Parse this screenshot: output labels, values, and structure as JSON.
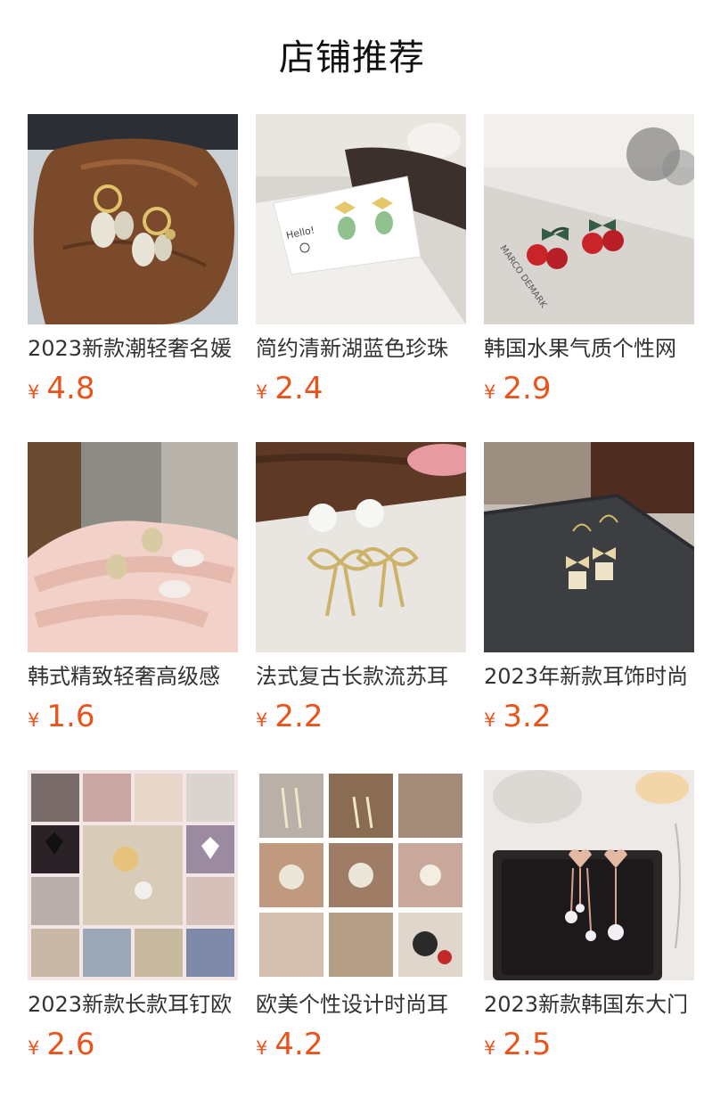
{
  "header": {
    "title": "店铺推荐"
  },
  "colors": {
    "price": "#e8541c",
    "text": "#333333"
  },
  "currency_symbol": "¥",
  "products": [
    {
      "name": "2023新款潮轻奢名媛",
      "price": "4.8",
      "image": "gold-rhinestone-leaf-hoop-earrings-on-wood"
    },
    {
      "name": "简约清新湖蓝色珍珠",
      "price": "2.4",
      "image": "gold-bow-green-drop-earrings-on-hello-card"
    },
    {
      "name": "韩国水果气质个性网",
      "price": "2.9",
      "image": "red-cherry-earrings-with-green-bow"
    },
    {
      "name": "韩式精致轻奢高级感",
      "price": "1.6",
      "image": "rhinestone-money-bag-stud-earrings-on-fingers"
    },
    {
      "name": "法式复古长款流苏耳",
      "price": "2.2",
      "image": "white-camellia-gold-bow-drop-earrings"
    },
    {
      "name": "2023年新款耳饰时尚",
      "price": "3.2",
      "image": "bow-and-opal-cube-drop-earrings-on-felt"
    },
    {
      "name": "2023新款长款耳钉欧",
      "price": "2.6",
      "image": "collage-of-assorted-earrings"
    },
    {
      "name": "欧美个性设计时尚耳",
      "price": "4.2",
      "image": "collage-of-crystal-tassel-earrings"
    },
    {
      "name": "2023新款韩国东大门",
      "price": "2.5",
      "image": "rhinestone-heart-chain-drop-earrings"
    }
  ]
}
